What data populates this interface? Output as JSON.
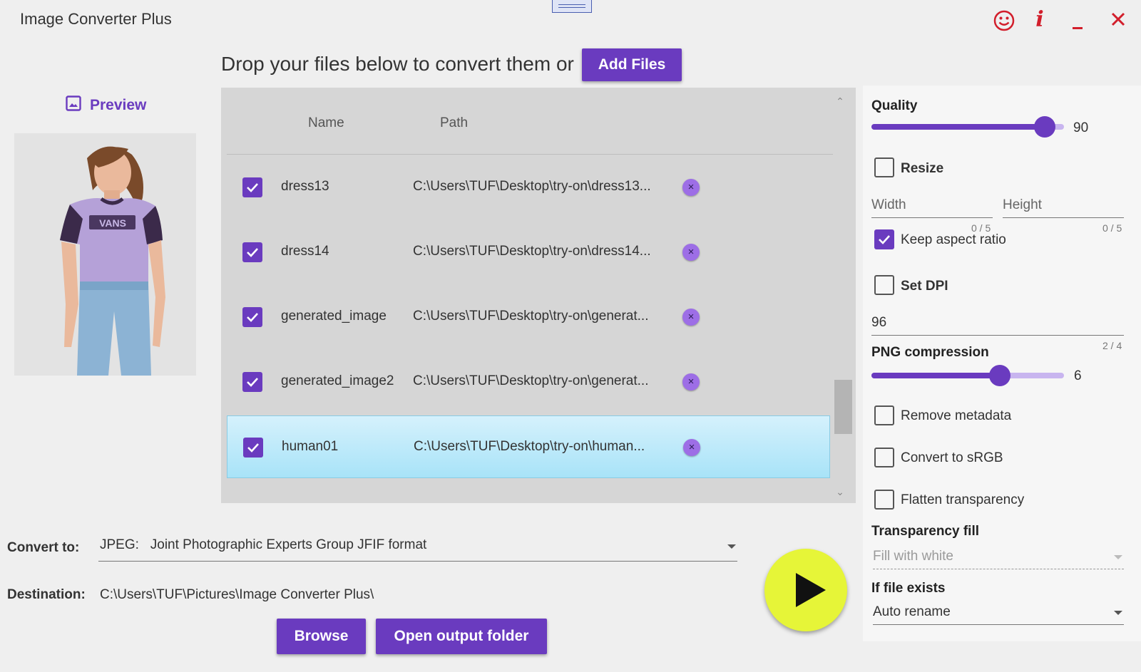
{
  "app": {
    "title": "Image Converter Plus"
  },
  "header": {
    "drop_text": "Drop your files below to convert them or",
    "add_files_label": "Add Files"
  },
  "preview": {
    "label": "Preview"
  },
  "file_list": {
    "columns": {
      "name": "Name",
      "path": "Path"
    },
    "rows": [
      {
        "name": "dress13",
        "path": "C:\\Users\\TUF\\Desktop\\try-on\\dress13...",
        "checked": true,
        "selected": false
      },
      {
        "name": "dress14",
        "path": "C:\\Users\\TUF\\Desktop\\try-on\\dress14...",
        "checked": true,
        "selected": false
      },
      {
        "name": "generated_image",
        "path": "C:\\Users\\TUF\\Desktop\\try-on\\generat...",
        "checked": true,
        "selected": false
      },
      {
        "name": "generated_image2",
        "path": "C:\\Users\\TUF\\Desktop\\try-on\\generat...",
        "checked": true,
        "selected": false
      },
      {
        "name": "human01",
        "path": "C:\\Users\\TUF\\Desktop\\try-on\\human...",
        "checked": true,
        "selected": true
      }
    ],
    "remove_glyph": "×"
  },
  "convert": {
    "label": "Convert to:",
    "format_code": "JPEG:",
    "format_desc": "Joint Photographic Experts Group JFIF format"
  },
  "destination": {
    "label": "Destination:",
    "path": "C:\\Users\\TUF\\Pictures\\Image Converter Plus\\"
  },
  "buttons": {
    "browse": "Browse",
    "open_output": "Open output folder"
  },
  "settings": {
    "quality": {
      "label": "Quality",
      "value": "90",
      "fraction": 0.9
    },
    "resize": {
      "label": "Resize",
      "checked": false
    },
    "width": {
      "placeholder": "Width",
      "counter": "0 / 5"
    },
    "height": {
      "placeholder": "Height",
      "counter": "0 / 5"
    },
    "keep_aspect": {
      "label": "Keep aspect ratio",
      "checked": true
    },
    "set_dpi": {
      "label": "Set DPI",
      "checked": false
    },
    "dpi": {
      "value": "96",
      "counter": "2 / 4"
    },
    "png_compression": {
      "label": "PNG compression",
      "value": "6",
      "fraction": 0.667
    },
    "remove_metadata": {
      "label": "Remove metadata",
      "checked": false
    },
    "convert_srgb": {
      "label": "Convert to sRGB",
      "checked": false
    },
    "flatten_transparency": {
      "label": "Flatten transparency",
      "checked": false
    },
    "transparency_fill": {
      "label": "Transparency fill",
      "value": "Fill with white"
    },
    "if_file_exists": {
      "label": "If file exists",
      "value": "Auto rename"
    }
  },
  "colors": {
    "accent": "#6a3bbf",
    "play": "#e6f538",
    "window_controls": "#d21e2b",
    "selected_row": "#a8e3f8"
  },
  "icons": {
    "feedback": "smiley-icon",
    "info": "info-icon",
    "minimize": "minimize-icon",
    "close": "close-icon",
    "preview": "image-icon",
    "play": "play-icon"
  }
}
